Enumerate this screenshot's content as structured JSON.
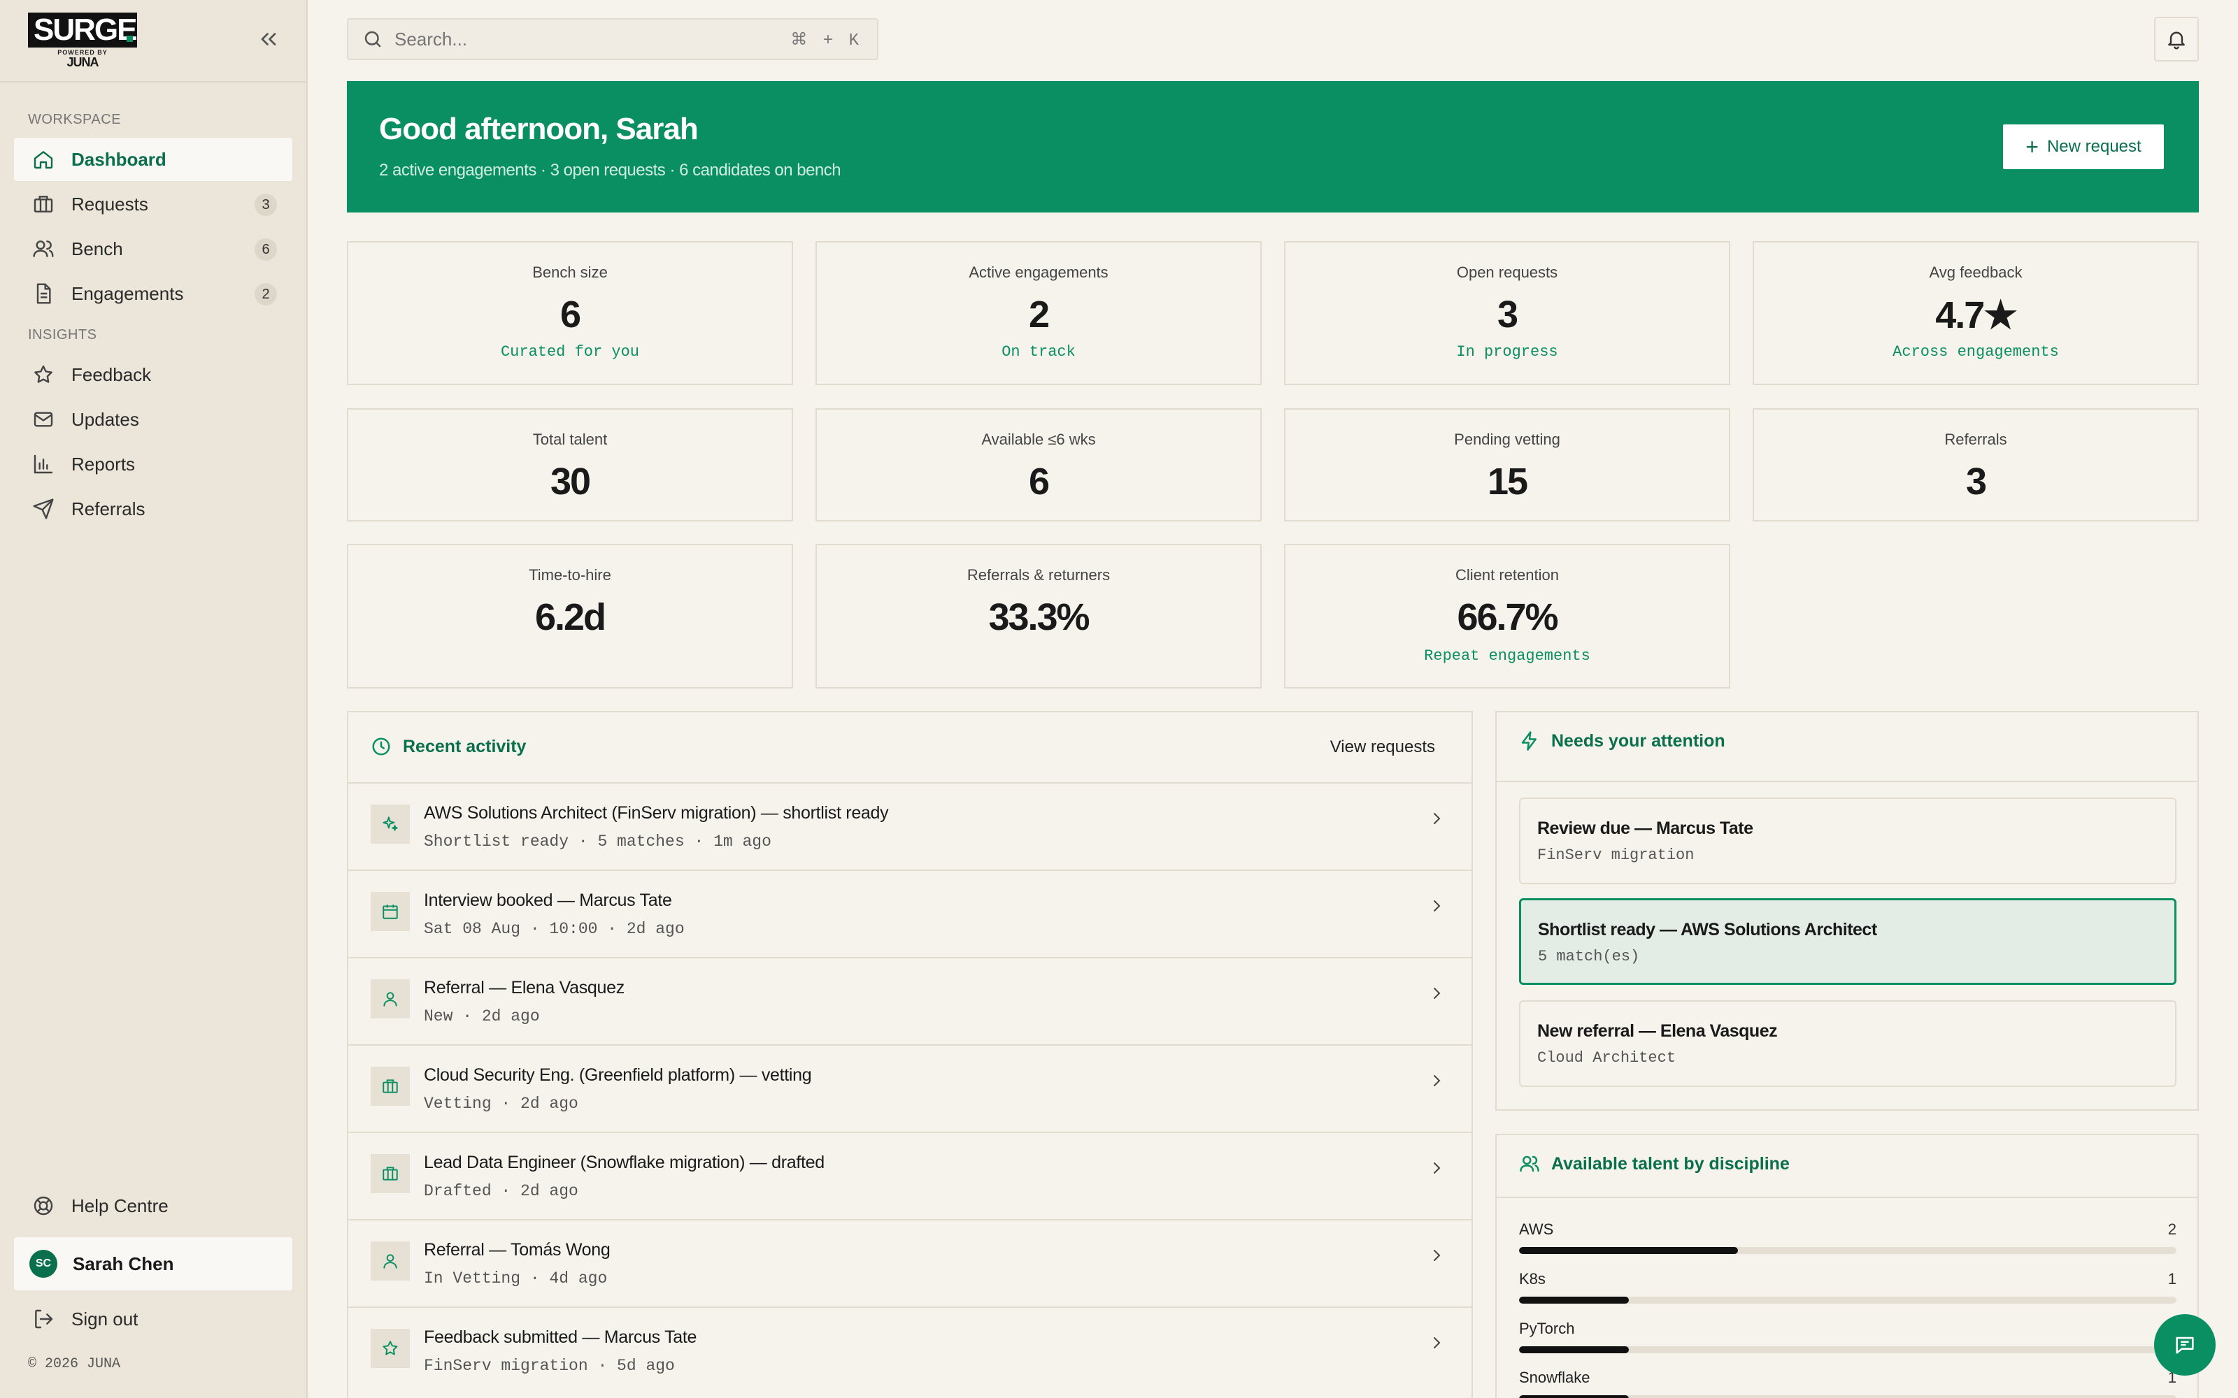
{
  "brand": {
    "name": "SURGE",
    "powered_by": "POWERED BY",
    "parent": "JUNA"
  },
  "sidebar": {
    "workspace_label": "WORKSPACE",
    "insights_label": "INSIGHTS",
    "workspace_items": [
      {
        "label": "Dashboard",
        "icon": "home-icon"
      },
      {
        "label": "Requests",
        "icon": "briefcase-icon",
        "badge": "3"
      },
      {
        "label": "Bench",
        "icon": "users-icon",
        "badge": "6"
      },
      {
        "label": "Engagements",
        "icon": "document-icon",
        "badge": "2"
      }
    ],
    "insights_items": [
      {
        "label": "Feedback",
        "icon": "star-icon"
      },
      {
        "label": "Updates",
        "icon": "mail-icon"
      },
      {
        "label": "Reports",
        "icon": "bar-chart-icon"
      },
      {
        "label": "Referrals",
        "icon": "send-icon"
      }
    ],
    "help_label": "Help Centre",
    "user": {
      "initials": "SC",
      "name": "Sarah Chen"
    },
    "sign_out_label": "Sign out",
    "copyright": "© 2026 JUNA"
  },
  "search": {
    "placeholder": "Search...",
    "shortcut": "⌘ + K"
  },
  "banner": {
    "greeting": "Good afternoon, Sarah",
    "summary": "2 active engagements · 3 open requests · 6 candidates on bench",
    "new_request_label": "New request"
  },
  "stats": [
    {
      "label": "Bench size",
      "value": "6",
      "sub": "Curated for you"
    },
    {
      "label": "Active engagements",
      "value": "2",
      "sub": "On track"
    },
    {
      "label": "Open requests",
      "value": "3",
      "sub": "In progress"
    },
    {
      "label": "Avg feedback",
      "value": "4.7★",
      "sub": "Across engagements"
    },
    {
      "label": "Total talent",
      "value": "30"
    },
    {
      "label": "Available ≤6 wks",
      "value": "6"
    },
    {
      "label": "Pending vetting",
      "value": "15"
    },
    {
      "label": "Referrals",
      "value": "3"
    },
    {
      "label": "Time-to-hire",
      "value": "6.2d"
    },
    {
      "label": "Referrals & returners",
      "value": "33.3%"
    },
    {
      "label": "Client retention",
      "value": "66.7%",
      "sub": "Repeat engagements"
    }
  ],
  "activity": {
    "title": "Recent activity",
    "view_label": "View requests",
    "items": [
      {
        "icon": "sparkle-icon",
        "title": "AWS Solutions Architect (FinServ migration) — shortlist ready",
        "sub": "Shortlist ready · 5 matches · 1m ago"
      },
      {
        "icon": "calendar-icon",
        "title": "Interview booked — Marcus Tate",
        "sub": "Sat 08 Aug · 10:00 · 2d ago"
      },
      {
        "icon": "user-icon",
        "title": "Referral — Elena Vasquez",
        "sub": "New · 2d ago"
      },
      {
        "icon": "briefcase-icon",
        "title": "Cloud Security Eng. (Greenfield platform) — vetting",
        "sub": "Vetting · 2d ago"
      },
      {
        "icon": "briefcase-icon",
        "title": "Lead Data Engineer (Snowflake migration) — drafted",
        "sub": "Drafted · 2d ago"
      },
      {
        "icon": "user-icon",
        "title": "Referral — Tomás Wong",
        "sub": "In Vetting · 4d ago"
      },
      {
        "icon": "star-icon",
        "title": "Feedback submitted — Marcus Tate",
        "sub": "FinServ migration · 5d ago"
      }
    ]
  },
  "attention": {
    "title": "Needs your attention",
    "items": [
      {
        "title": "Review due — Marcus Tate",
        "sub": "FinServ migration"
      },
      {
        "title": "Shortlist ready — AWS Solutions Architect",
        "sub": "5 match(es)",
        "highlighted": true
      },
      {
        "title": "New referral — Elena Vasquez",
        "sub": "Cloud Architect"
      }
    ]
  },
  "talent": {
    "title": "Available talent by discipline",
    "items": [
      {
        "name": "AWS",
        "count": "2",
        "fraction": 0.333
      },
      {
        "name": "K8s",
        "count": "1",
        "fraction": 0.167
      },
      {
        "name": "PyTorch",
        "count": "1",
        "fraction": 0.167
      },
      {
        "name": "Snowflake",
        "count": "1",
        "fraction": 0.167
      }
    ]
  },
  "colors": {
    "accent": "#0a8f63",
    "accent_dark": "#0a6f4d",
    "background": "#f6f3ed",
    "sidebar": "#ebe5da"
  }
}
